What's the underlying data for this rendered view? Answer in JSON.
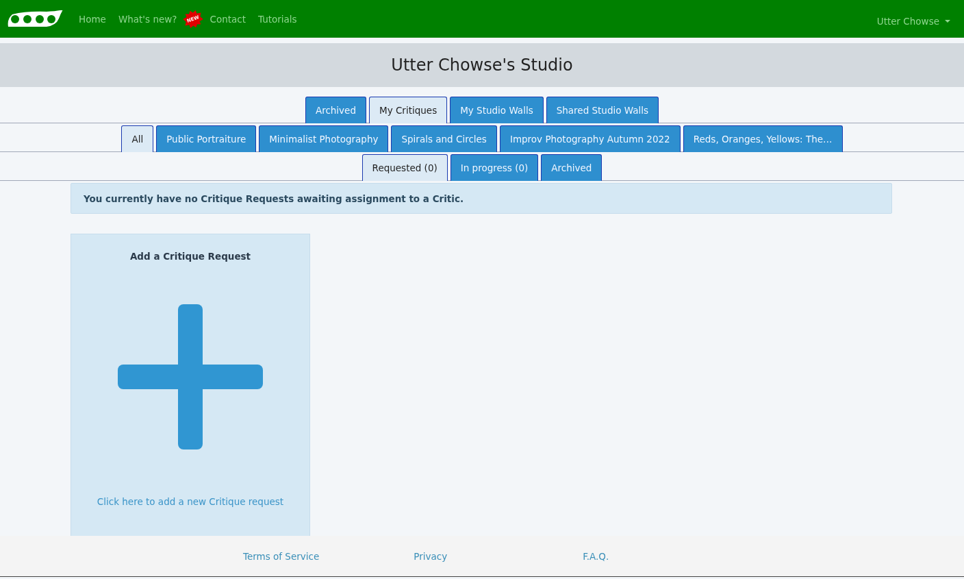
{
  "navbar": {
    "links": [
      {
        "label": "Home"
      },
      {
        "label": "What's new?",
        "badge": "NEW"
      },
      {
        "label": "Contact"
      },
      {
        "label": "Tutorials"
      }
    ],
    "user": {
      "label": "Utter Chowse"
    }
  },
  "title": "Utter Chowse's Studio",
  "tab_rows": [
    {
      "tabs": [
        {
          "label": "Archived",
          "selected": false
        },
        {
          "label": "My Critiques",
          "selected": true
        },
        {
          "label": "My Studio Walls",
          "selected": false
        },
        {
          "label": "Shared Studio Walls",
          "selected": false
        }
      ]
    },
    {
      "tabs": [
        {
          "label": "All",
          "selected": true
        },
        {
          "label": "Public Portraiture",
          "selected": false
        },
        {
          "label": "Minimalist Photography",
          "selected": false
        },
        {
          "label": "Spirals and Circles",
          "selected": false
        },
        {
          "label": "Improv Photography Autumn 2022",
          "selected": false
        },
        {
          "label": "Reds, Oranges, Yellows: The…",
          "selected": false
        }
      ]
    },
    {
      "tabs": [
        {
          "label": "Requested (0)",
          "selected": true
        },
        {
          "label": "In progress (0)",
          "selected": false
        },
        {
          "label": "Archived",
          "selected": false
        }
      ]
    }
  ],
  "alert": "You currently have no Critique Requests awaiting assignment to a Critic.",
  "add_card": {
    "title": "Add a Critique Request",
    "link": "Click here to add a new Critique request"
  },
  "footer": {
    "links": [
      "Terms of Service",
      "Privacy",
      "F.A.Q."
    ]
  }
}
